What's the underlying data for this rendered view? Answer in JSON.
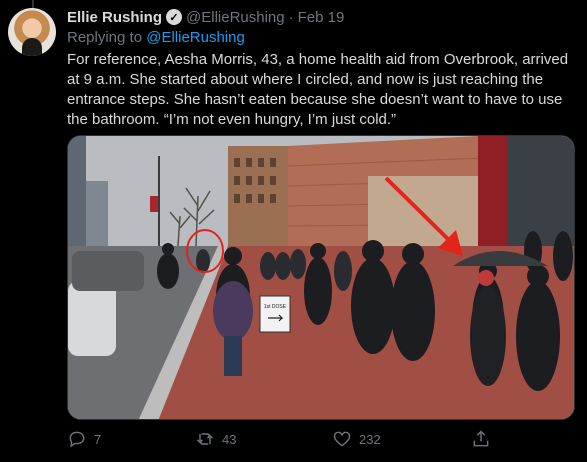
{
  "tweet": {
    "author_name": "Ellie Rushing",
    "handle": "@EllieRushing",
    "separator": "·",
    "date": "Feb 19",
    "replying_label": "Replying to ",
    "replying_to": "@EllieRushing",
    "text": "For reference, Aesha Morris, 43, a home health aid from Overbrook, arrived at 9 a.m. She started about where I circled, and now is just reaching the entrance steps. She hasn’t eaten because she doesn’t want to have to use the bathroom. “I’m not even hungry, I’m just cold.”"
  },
  "media": {
    "sign_text": "1st DOSE"
  },
  "actions": {
    "reply_count": "7",
    "retweet_count": "43",
    "like_count": "232"
  },
  "icons": {
    "verified": "verified-badge-icon",
    "reply": "reply-icon",
    "retweet": "retweet-icon",
    "like": "heart-icon",
    "share": "share-icon"
  },
  "colors": {
    "background": "#000000",
    "link": "#1d9bf0",
    "muted": "#6e767d",
    "text": "#d9d9d9",
    "annotation_red": "#e3241b"
  }
}
